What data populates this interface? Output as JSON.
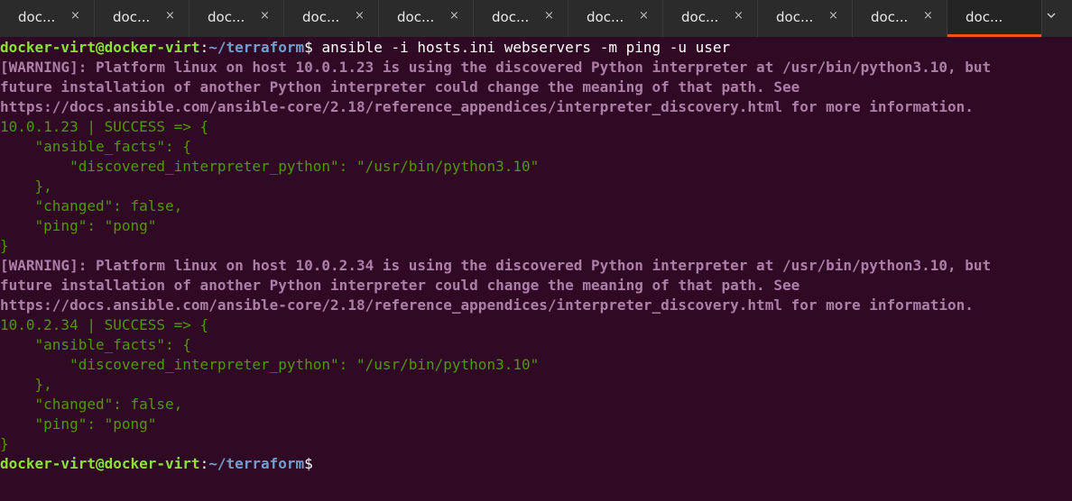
{
  "tabs": [
    {
      "label": "doc...",
      "close": "×"
    },
    {
      "label": "doc...",
      "close": "×"
    },
    {
      "label": "doc...",
      "close": "×"
    },
    {
      "label": "doc...",
      "close": "×"
    },
    {
      "label": "doc...",
      "close": "×"
    },
    {
      "label": "doc...",
      "close": "×"
    },
    {
      "label": "doc...",
      "close": "×"
    },
    {
      "label": "doc...",
      "close": "×"
    },
    {
      "label": "doc...",
      "close": "×"
    },
    {
      "label": "doc...",
      "close": "×"
    },
    {
      "label": "doc...",
      "close": "",
      "active": true
    }
  ],
  "tab_overflow_icon": "chevron-down-icon",
  "colors": {
    "background": "#300a24",
    "prompt_user": "#8ae234",
    "prompt_path": "#729fcf",
    "warning": "#ad7fa8",
    "success": "#4e9a06",
    "active_tab_accent": "#e95420"
  },
  "terminal": {
    "prompt1": {
      "user": "docker-virt@docker-virt",
      "colon": ":",
      "path": "~/terraform",
      "dollar": "$",
      "command": " ansible -i hosts.ini webservers -m ping -u user"
    },
    "host1": {
      "warn1": "[WARNING]: Platform linux on host 10.0.1.23 is using the discovered Python interpreter at /usr/bin/python3.10, but",
      "warn2": "future installation of another Python interpreter could change the meaning of that path. See",
      "warn3": "https://docs.ansible.com/ansible-core/2.18/reference_appendices/interpreter_discovery.html for more information.",
      "out1": "10.0.1.23 | SUCCESS => {",
      "out2": "    \"ansible_facts\": {",
      "out3": "        \"discovered_interpreter_python\": \"/usr/bin/python3.10\"",
      "out4": "    },",
      "out5": "    \"changed\": false,",
      "out6": "    \"ping\": \"pong\"",
      "out7": "}"
    },
    "host2": {
      "warn1": "[WARNING]: Platform linux on host 10.0.2.34 is using the discovered Python interpreter at /usr/bin/python3.10, but",
      "warn2": "future installation of another Python interpreter could change the meaning of that path. See",
      "warn3": "https://docs.ansible.com/ansible-core/2.18/reference_appendices/interpreter_discovery.html for more information.",
      "out1": "10.0.2.34 | SUCCESS => {",
      "out2": "    \"ansible_facts\": {",
      "out3": "        \"discovered_interpreter_python\": \"/usr/bin/python3.10\"",
      "out4": "    },",
      "out5": "    \"changed\": false,",
      "out6": "    \"ping\": \"pong\"",
      "out7": "}"
    },
    "prompt2": {
      "user": "docker-virt@docker-virt",
      "colon": ":",
      "path": "~/terraform",
      "dollar": "$"
    }
  }
}
